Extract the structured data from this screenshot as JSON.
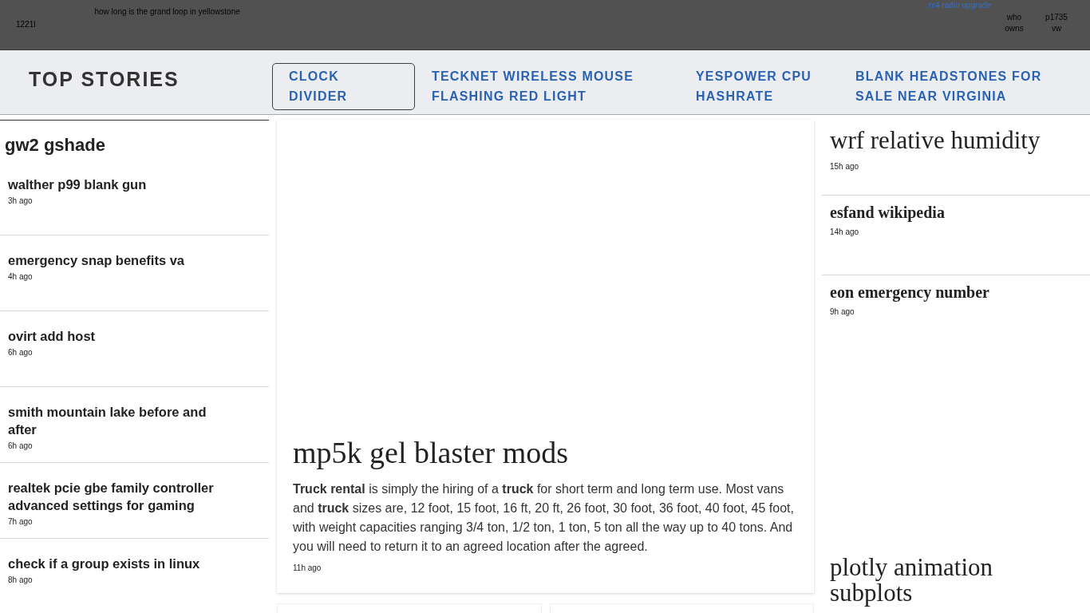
{
  "top_bar": {
    "code": "1221l",
    "query_link": "how long is the grand loop in yellowstone",
    "highlight_link": "rx4 radio upgrade",
    "links": [
      "who owns",
      "p1735 vw"
    ]
  },
  "nav": {
    "title": "TOP STORIES",
    "items": [
      {
        "label": "CLOCK DIVIDER",
        "selected": true
      },
      {
        "label": "TECKNET WIRELESS MOUSE FLASHING RED LIGHT",
        "selected": false
      },
      {
        "label": "YESPOWER CPU HASHRATE",
        "selected": false
      },
      {
        "label": "BLANK HEADSTONES FOR SALE NEAR VIRGINIA",
        "selected": false
      }
    ]
  },
  "sidebar": {
    "heading": "gw2 gshade",
    "stories": [
      {
        "title": "walther p99 blank gun",
        "time": "3h ago"
      },
      {
        "title": "emergency snap benefits va",
        "time": "4h ago"
      },
      {
        "title": "ovirt add host",
        "time": "6h ago"
      },
      {
        "title": "smith mountain lake before and after",
        "time": "6h ago"
      },
      {
        "title": "realtek pcie gbe family controller advanced settings for gaming",
        "time": "7h ago"
      },
      {
        "title": "check if a group exists in linux",
        "time": "8h ago"
      }
    ]
  },
  "featured": {
    "title": "mp5k gel blaster mods",
    "summary": "**Truck rental** is simply the hiring of a **truck** for short term and long term use. Most vans and **truck** sizes are, 12 foot, 15 foot, 16 ft, 20 ft, 26 foot, 30 foot, 36 foot, 40 foot, 45 foot, with weight capacities ranging 3/4 ton, 1/2 ton, 1 ton, 5 ton all the way up to 40 tons. And you will need to return it to an agreed location after the agreed.",
    "time": "11h ago"
  },
  "right_column": {
    "stories": [
      {
        "kind": "headline",
        "title": "wrf relative humidity",
        "time": "15h ago"
      },
      {
        "kind": "brief",
        "title": "esfand wikipedia",
        "time": "14h ago"
      },
      {
        "kind": "brief",
        "title": "eon emergency number",
        "time": "9h ago"
      },
      {
        "kind": "feature",
        "title": "plotly animation subplots"
      }
    ]
  }
}
